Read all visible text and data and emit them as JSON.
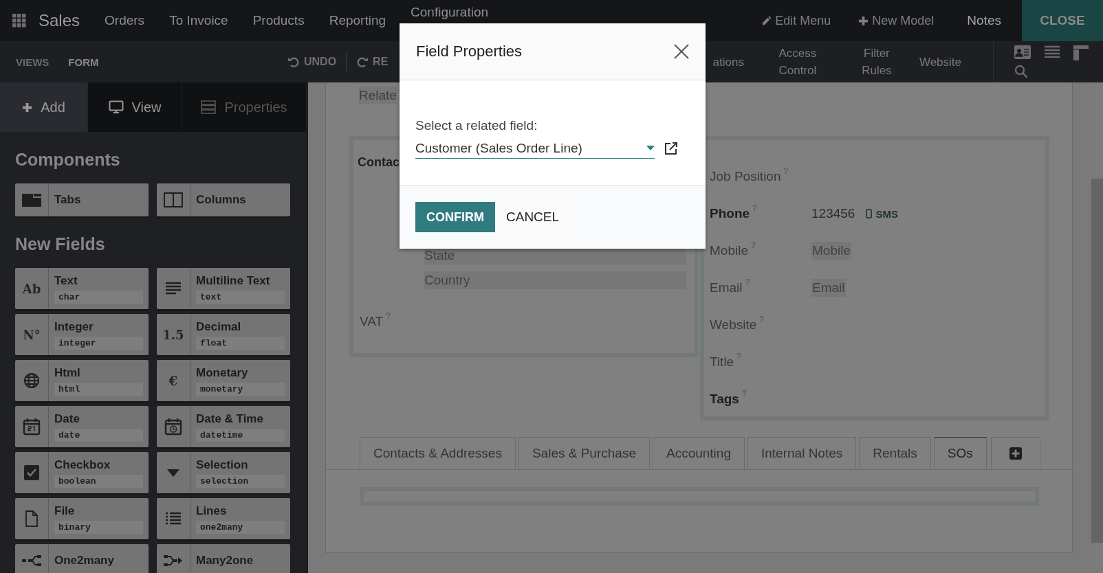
{
  "navbar": {
    "app_name": "Sales",
    "menu": [
      "Orders",
      "To Invoice",
      "Products",
      "Reporting",
      "Configuration"
    ],
    "actions": [
      {
        "kind": "edit",
        "label": "Edit Menu"
      },
      {
        "kind": "add",
        "label": "New Model"
      },
      {
        "kind": "plain",
        "label": "Notes"
      }
    ],
    "close_label": "CLOSE"
  },
  "toolbar": {
    "breadcrumbs": [
      "VIEWS",
      "FORM"
    ],
    "undo": "UNDO",
    "redo": "RE",
    "links": [
      "ations",
      "Access Control",
      "Filter Rules",
      "Website"
    ]
  },
  "sidebar": {
    "tabs": [
      {
        "kind": "add",
        "label": "Add",
        "selected": true,
        "disabled": false
      },
      {
        "kind": "view",
        "label": "View",
        "selected": false,
        "disabled": false
      },
      {
        "kind": "properties",
        "label": "Properties",
        "selected": false,
        "disabled": true
      }
    ],
    "sections": [
      {
        "title": "Components",
        "items": [
          {
            "kind": "tabs",
            "label": "Tabs"
          },
          {
            "kind": "columns",
            "label": "Columns"
          }
        ]
      },
      {
        "title": "New Fields",
        "items": [
          {
            "kind": "glyph",
            "glyph": "Ab",
            "label": "Text",
            "type": "char"
          },
          {
            "kind": "lines",
            "label": "Multiline Text",
            "type": "text"
          },
          {
            "kind": "glyph",
            "glyph": "N°",
            "label": "Integer",
            "type": "integer"
          },
          {
            "kind": "glyph",
            "glyph": "1.5",
            "label": "Decimal",
            "type": "float"
          },
          {
            "kind": "globe",
            "label": "Html",
            "type": "html"
          },
          {
            "kind": "glyph",
            "glyph": "€",
            "label": "Monetary",
            "type": "monetary"
          },
          {
            "kind": "calendar",
            "label": "Date",
            "type": "date"
          },
          {
            "kind": "clock",
            "label": "Date & Time",
            "type": "datetime"
          },
          {
            "kind": "checkbox",
            "label": "Checkbox",
            "type": "boolean"
          },
          {
            "kind": "caret",
            "label": "Selection",
            "type": "selection"
          },
          {
            "kind": "file",
            "label": "File",
            "type": "binary"
          },
          {
            "kind": "list",
            "label": "Lines",
            "type": "one2many"
          },
          {
            "kind": "split",
            "label": "One2many"
          },
          {
            "kind": "merge",
            "label": "Many2one"
          }
        ]
      }
    ]
  },
  "form": {
    "related_label": "Relate",
    "left_group": {
      "heading": "Contac",
      "placeholders": [
        "State",
        "Country"
      ],
      "fields": [
        {
          "label": "VAT",
          "help": "?",
          "required": false
        }
      ]
    },
    "right_group": {
      "fields": [
        {
          "label": "Job Position",
          "help": "?",
          "required": false
        },
        {
          "label": "Phone",
          "help": "?",
          "required": true,
          "value": "123456",
          "action": "SMS"
        },
        {
          "label": "Mobile",
          "help": "?",
          "required": false,
          "placeholder": "Mobile"
        },
        {
          "label": "Email",
          "help": "?",
          "required": false,
          "placeholder": "Email"
        },
        {
          "label": "Website",
          "help": "?",
          "required": false
        },
        {
          "label": "Title",
          "help": "?",
          "required": false
        },
        {
          "label": "Tags",
          "help": "?",
          "required": true
        }
      ]
    },
    "notebook": [
      {
        "label": "Contacts & Addresses",
        "selected": false
      },
      {
        "label": "Sales & Purchase",
        "selected": false
      },
      {
        "label": "Accounting",
        "selected": false
      },
      {
        "label": "Internal Notes",
        "selected": false
      },
      {
        "label": "Rentals",
        "selected": false
      },
      {
        "label": "SOs",
        "selected": true
      }
    ]
  },
  "dialog": {
    "title": "Field Properties",
    "field_label": "Select a related field:",
    "value": "Customer (Sales Order Line)",
    "buttons": [
      {
        "label": "CONFIRM",
        "primary": true
      },
      {
        "label": "CANCEL",
        "primary": false
      }
    ]
  }
}
